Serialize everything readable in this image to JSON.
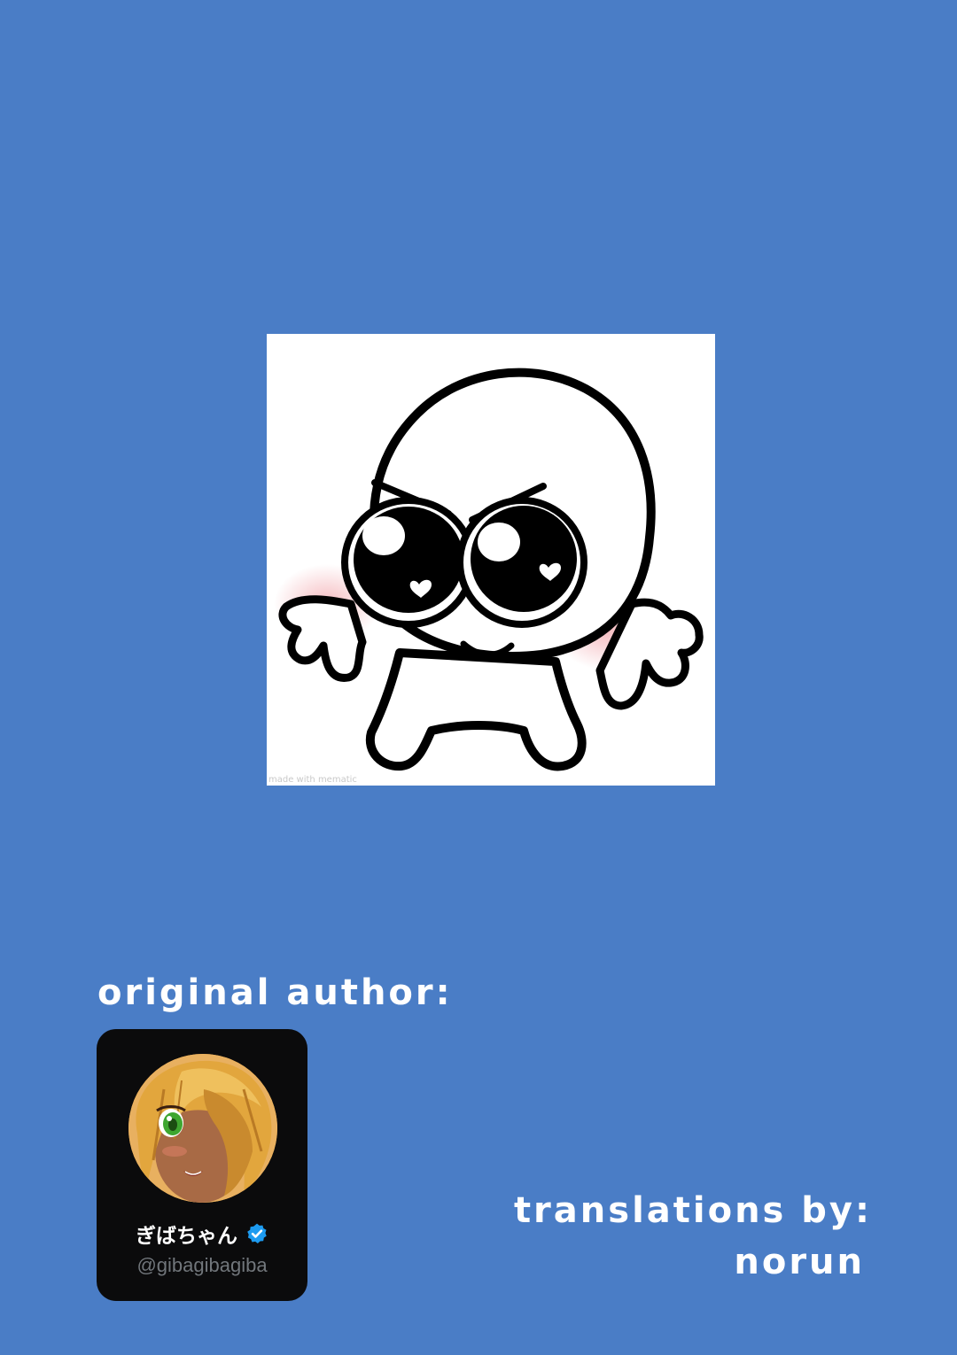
{
  "meme": {
    "watermark": "made with mematic"
  },
  "credits": {
    "author_label": "original author:",
    "author_profile": {
      "display_name": "ぎばちゃん",
      "handle": "@gibagibagiba",
      "verified": true,
      "verified_color": "#1d9bf0",
      "card_background": "#0b0b0c"
    },
    "translator_label": "translations by:",
    "translator_name": "norun"
  },
  "colors": {
    "page_background": "#4a7dc6",
    "text": "#ffffff",
    "handle_text": "#71767b"
  },
  "icons": {
    "verified": "verified-badge-icon"
  }
}
